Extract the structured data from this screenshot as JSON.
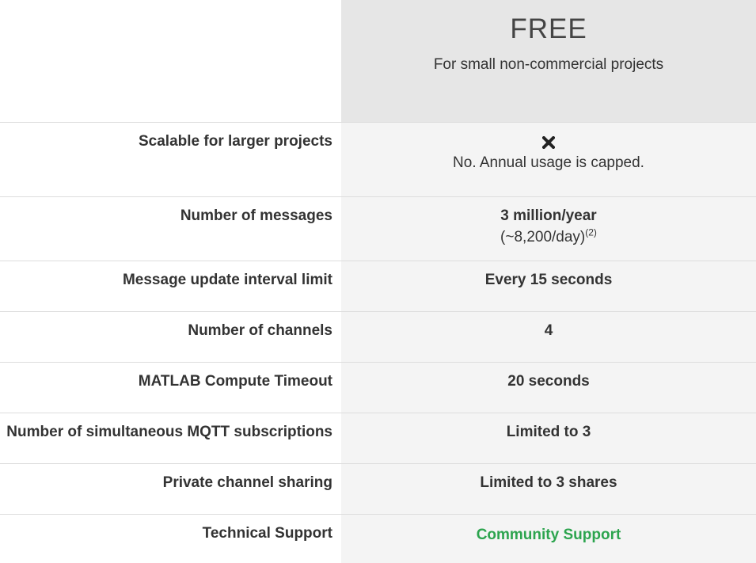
{
  "plan": {
    "name": "FREE",
    "tagline": "For small non-commercial projects"
  },
  "rows": [
    {
      "label": "Scalable for larger projects",
      "value": "No. Annual usage is capped.",
      "icon": "x-mark-icon"
    },
    {
      "label": "Number of messages",
      "value": "3 million/year",
      "sub": "(~8,200/day)",
      "sup": "(2)"
    },
    {
      "label": "Message update interval limit",
      "value": "Every 15 seconds"
    },
    {
      "label": "Number of channels",
      "value": "4"
    },
    {
      "label": "MATLAB Compute Timeout",
      "value": "20 seconds"
    },
    {
      "label": "Number of simultaneous MQTT subscriptions",
      "value": "Limited to 3"
    },
    {
      "label": "Private channel sharing",
      "value": "Limited to 3 shares"
    },
    {
      "label": "Technical Support",
      "value": "Community Support",
      "link_color": "#2ca44e"
    }
  ]
}
